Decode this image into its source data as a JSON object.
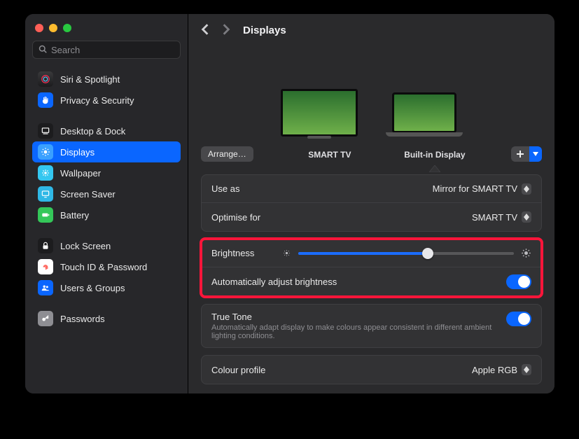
{
  "search": {
    "placeholder": "Search"
  },
  "sidebar": {
    "items": [
      {
        "label": "Siri & Spotlight"
      },
      {
        "label": "Privacy & Security"
      },
      {
        "label": "Desktop & Dock"
      },
      {
        "label": "Displays"
      },
      {
        "label": "Wallpaper"
      },
      {
        "label": "Screen Saver"
      },
      {
        "label": "Battery"
      },
      {
        "label": "Lock Screen"
      },
      {
        "label": "Touch ID & Password"
      },
      {
        "label": "Users & Groups"
      },
      {
        "label": "Passwords"
      }
    ]
  },
  "header": {
    "title": "Displays"
  },
  "displays": {
    "arrange_label": "Arrange…",
    "tv": "SMART TV",
    "builtin": "Built-in Display"
  },
  "settings": {
    "use_as": {
      "label": "Use as",
      "value": "Mirror for SMART TV"
    },
    "optimise": {
      "label": "Optimise for",
      "value": "SMART TV"
    },
    "brightness": {
      "label": "Brightness",
      "percent": 60
    },
    "auto_brightness": {
      "label": "Automatically adjust brightness"
    },
    "truetone": {
      "label": "True Tone",
      "desc": "Automatically adapt display to make colours appear consistent in different ambient lighting conditions."
    },
    "colour_profile": {
      "label": "Colour profile",
      "value": "Apple RGB"
    }
  }
}
